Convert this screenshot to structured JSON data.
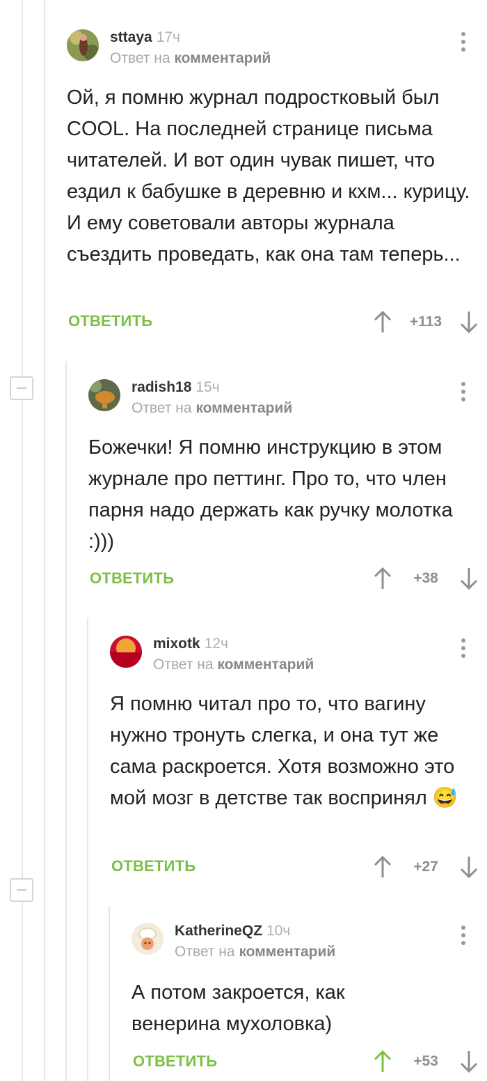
{
  "reply_label": "ОТВЕТИТЬ",
  "reply_to_prefix": "Ответ на",
  "reply_to_link": "комментарий",
  "colors": {
    "accent": "#7cbf45",
    "muted": "#a8a8a8",
    "upvoted": "#7cbf45"
  },
  "comments": [
    {
      "user": "sttaya",
      "time": "17ч",
      "body": "Ой, я помню журнал подростковый был COOL. На последней странице письма читателей. И вот один чувак пишет, что ездил к бабушке в деревню и кхм... курицу. И ему советовали авторы журнала съездить проведать, как она там теперь...",
      "score": "+113",
      "upvoted": false
    },
    {
      "user": "radish18",
      "time": "15ч",
      "body": "Божечки! Я помню инструкцию в этом журнале про петтинг. Про то, что член парня надо держать как ручку молотка :)))",
      "score": "+38",
      "upvoted": false
    },
    {
      "user": "mixotk",
      "time": "12ч",
      "body": "Я помню читал про то, что вагину нужно тронуть слегка, и она тут же сама раскроется. Хотя возможно это мой мозг в детстве так воспринял",
      "emoji": "😅",
      "score": "+27",
      "upvoted": false
    },
    {
      "user": "KatherineQZ",
      "time": "10ч",
      "body": "А потом закроется, как венерина мухоловка)",
      "score": "+53",
      "upvoted": true
    }
  ]
}
